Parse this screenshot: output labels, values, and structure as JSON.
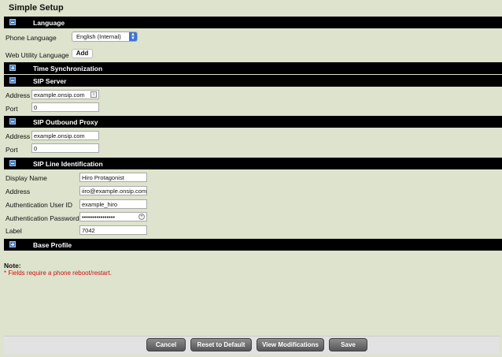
{
  "page_title": "Simple Setup",
  "sections": {
    "language": "Language",
    "time_sync": "Time Synchronization",
    "sip_server": "SIP Server",
    "sip_proxy": "SIP Outbound Proxy",
    "sip_line": "SIP Line Identification",
    "base_profile": "Base Profile"
  },
  "language": {
    "phone_label": "Phone Language",
    "phone_value": "English (Internal)",
    "web_label": "Web Utility Language",
    "add_label": "Add"
  },
  "sip_server": {
    "address_label": "Address",
    "address_value": "example.onsip.com",
    "port_label": "Port",
    "port_value": "0"
  },
  "sip_proxy": {
    "address_label": "Address",
    "address_value": "example.onsip.com",
    "port_label": "Port",
    "port_value": "0"
  },
  "sip_line": {
    "display_name_label": "Display Name",
    "display_name_value": "Hiro Protagonist",
    "address_label": "Address",
    "address_value": "iiro@example.onsip.com",
    "auth_user_label": "Authentication User ID",
    "auth_user_value": "example_hiro",
    "auth_pass_label": "Authentication Password",
    "auth_pass_value": "••••••••••••••••",
    "label_label": "Label",
    "label_value": "7042"
  },
  "note": {
    "title": "Note:",
    "text": "* Fields require a phone reboot/restart."
  },
  "buttons": {
    "cancel": "Cancel",
    "reset": "Reset to Default",
    "view_mods": "View Modifications",
    "save": "Save"
  },
  "colors": {
    "background": "#dde3cc",
    "section_bar": "#000000",
    "note_text": "#d01010"
  }
}
